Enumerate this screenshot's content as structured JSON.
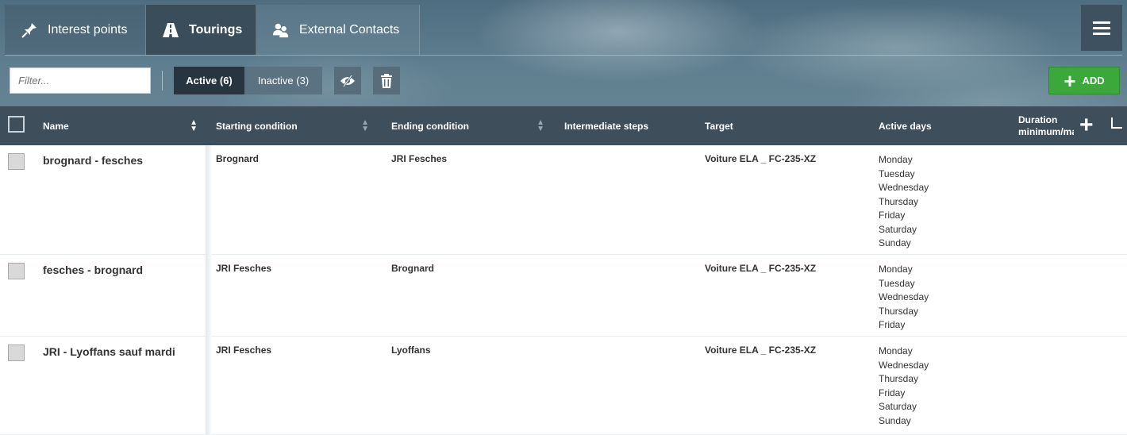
{
  "tabs": [
    {
      "label": "Interest points",
      "icon": "pin-icon"
    },
    {
      "label": "Tourings",
      "icon": "road-icon"
    },
    {
      "label": "External Contacts",
      "icon": "contacts-icon"
    }
  ],
  "toolbar": {
    "filter_placeholder": "Filter...",
    "active_label": "Active (6)",
    "inactive_label": "Inactive (3)",
    "add_label": "ADD"
  },
  "table": {
    "columns": {
      "name": "Name",
      "starting": "Starting condition",
      "ending": "Ending condition",
      "intermediate": "Intermediate steps",
      "target": "Target",
      "active_days": "Active days",
      "duration_1": "Duration",
      "duration_2": "minimum/ma"
    },
    "rows": [
      {
        "name": "brognard - fesches",
        "starting": "Brognard",
        "ending": "JRI Fesches",
        "intermediate": "",
        "target": "Voiture ELA _ FC-235-XZ",
        "days": [
          "Monday",
          "Tuesday",
          "Wednesday",
          "Thursday",
          "Friday",
          "Saturday",
          "Sunday"
        ]
      },
      {
        "name": "fesches - brognard",
        "starting": "JRI Fesches",
        "ending": "Brognard",
        "intermediate": "",
        "target": "Voiture ELA _ FC-235-XZ",
        "days": [
          "Monday",
          "Tuesday",
          "Wednesday",
          "Thursday",
          "Friday"
        ]
      },
      {
        "name": "JRI - Lyoffans sauf mardi",
        "starting": "JRI Fesches",
        "ending": "Lyoffans",
        "intermediate": "",
        "target": "Voiture ELA _ FC-235-XZ",
        "days": [
          "Monday",
          "Wednesday",
          "Thursday",
          "Friday",
          "Saturday",
          "Sunday"
        ]
      }
    ]
  },
  "colors": {
    "header_bg": "#3e4f5b",
    "active_tab": "#3a4d5a",
    "add_green": "#3aa83a"
  }
}
